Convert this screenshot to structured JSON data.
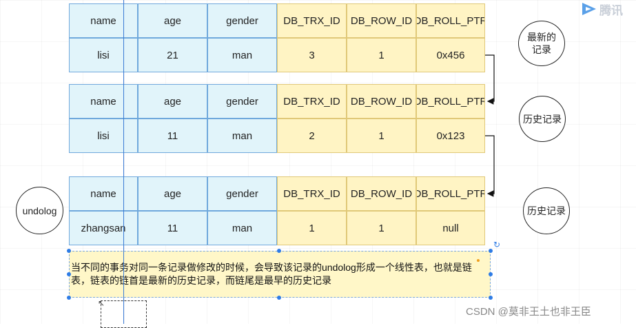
{
  "columns": [
    "name",
    "age",
    "gender",
    "DB_TRX_ID",
    "DB_ROW_ID",
    "DB_ROLL_PTR"
  ],
  "tables": [
    {
      "values": [
        "lisi",
        "21",
        "man",
        "3",
        "1",
        "0x456"
      ]
    },
    {
      "values": [
        "lisi",
        "11",
        "man",
        "2",
        "1",
        "0x123"
      ]
    },
    {
      "values": [
        "zhangsan",
        "11",
        "man",
        "1",
        "1",
        "null"
      ]
    }
  ],
  "circles": {
    "latest": "最新的记录",
    "history1": "历史记录",
    "history2": "历史记录",
    "undolog": "undolog"
  },
  "note": "当不同的事务对同一条记录做修改的时候，会导致该记录的undolog形成一个线性表，也就是链表，链表的链首是最新的历史记录，而链尾是最早的历史记录",
  "watermark": "CSDN @莫非王土也非王臣",
  "logo_text": "腾讯",
  "colors": {
    "key_cells": "#e1f4fa",
    "hidden_cells": "#fff4c4",
    "note_bg": "#fff7c8",
    "selection": "#2e7ce6"
  }
}
